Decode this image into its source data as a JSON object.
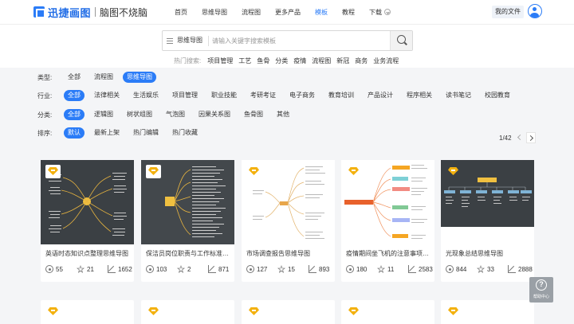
{
  "header": {
    "logo_name": "迅捷画图",
    "logo_slogan": "脑图不烧脑",
    "nav": [
      "首页",
      "思维导图",
      "流程图",
      "更多产品",
      "模板",
      "教程",
      "下载"
    ],
    "my_files": "我的文件"
  },
  "search": {
    "type_label": "思维导图",
    "placeholder": "请输入关键字搜索模板",
    "hot_label": "热门搜索:",
    "hot_items": [
      "项目管理",
      "工艺",
      "鱼骨",
      "分类",
      "疫情",
      "流程图",
      "新冠",
      "商务",
      "业务流程"
    ]
  },
  "filters": {
    "type": {
      "label": "类型:",
      "options": [
        "全部",
        "流程图",
        "思维导图"
      ]
    },
    "industry": {
      "label": "行业:",
      "options": [
        "全部",
        "法律相关",
        "生活娱乐",
        "项目管理",
        "职业技能",
        "考研考证",
        "电子商务",
        "教育培训",
        "产品设计",
        "程序相关",
        "读书笔记",
        "校园教育"
      ]
    },
    "category": {
      "label": "分类:",
      "options": [
        "全部",
        "逻辑图",
        "树状组图",
        "气泡图",
        "因果关系图",
        "鱼骨图",
        "其他"
      ]
    },
    "sort": {
      "label": "排序:",
      "options": [
        "默认",
        "最新上架",
        "热门编辑",
        "热门收藏"
      ]
    }
  },
  "pager": {
    "text": "1/42"
  },
  "cards": [
    {
      "title": "英语时态知识点整理思维导图",
      "views": "55",
      "stars": "21",
      "edits": "1652"
    },
    {
      "title": "保洁员岗位职责与工作标准思维导图",
      "views": "103",
      "stars": "2",
      "edits": "871"
    },
    {
      "title": "市场调查报告思维导图",
      "views": "127",
      "stars": "15",
      "edits": "893"
    },
    {
      "title": "疫情期间坐飞机的注意事项思维导图",
      "views": "180",
      "stars": "11",
      "edits": "2583"
    },
    {
      "title": "光现象总结思维导图",
      "views": "844",
      "stars": "33",
      "edits": "2888"
    }
  ],
  "help": {
    "label": "帮助中心"
  },
  "colors": {
    "accent": "#2b7cf7",
    "badge": "#f3b10f",
    "dark_thumb": "#3b4044"
  }
}
